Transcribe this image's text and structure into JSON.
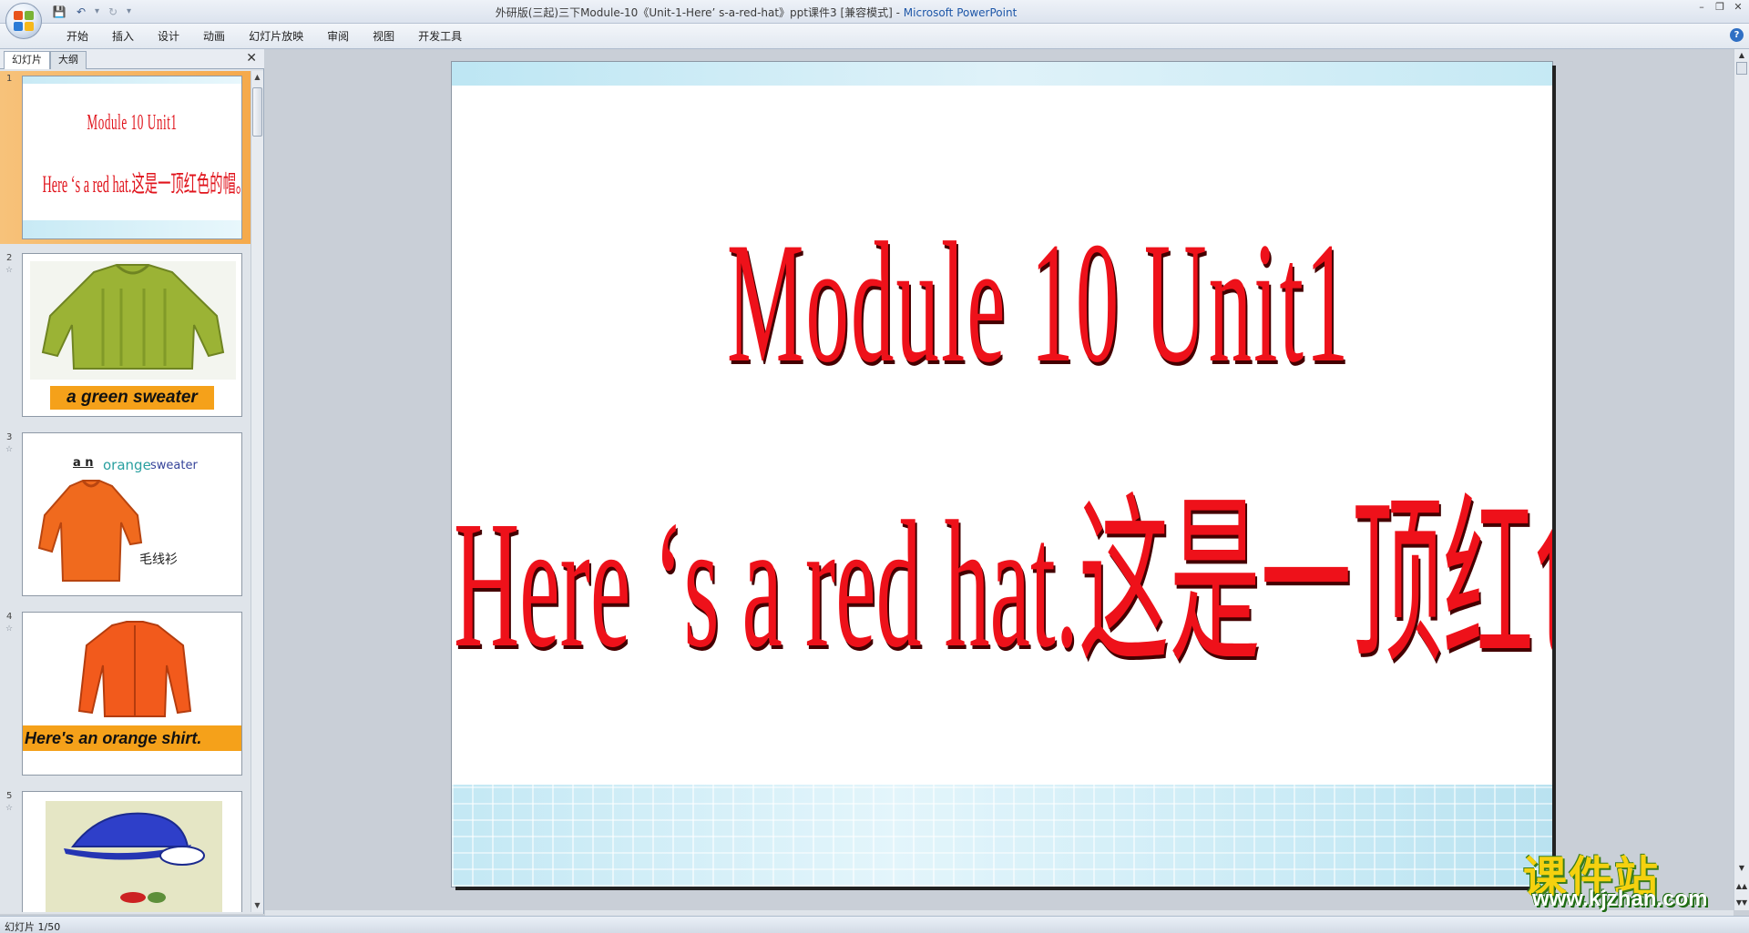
{
  "window": {
    "title": "外研版(三起)三下Module-10《Unit-1-Here’ s-a-red-hat》ppt课件3 [兼容模式] - ",
    "app_name": "Microsoft PowerPoint"
  },
  "ribbon": {
    "tabs": [
      "开始",
      "插入",
      "设计",
      "动画",
      "幻灯片放映",
      "审阅",
      "视图",
      "开发工具"
    ]
  },
  "left_panel": {
    "tab_slides": "幻灯片",
    "tab_outline": "大纲",
    "slides": [
      {
        "num": "1",
        "line1": "Module 10 Unit1",
        "line2": "Here ‘s a red hat.这是一顶红色的帽。."
      },
      {
        "num": "2",
        "label": "a  green  sweater"
      },
      {
        "num": "3",
        "article": "a n",
        "color_word": "orange",
        "noun": "sweater",
        "cn": "毛线衫"
      },
      {
        "num": "4",
        "label": "Here's an orange  shirt."
      },
      {
        "num": "5"
      }
    ]
  },
  "slide": {
    "title": "Module 10 Unit1",
    "subtitle": "Here ‘s a red hat.这是一顶红色的帽。."
  },
  "status": {
    "slide_counter": "幻灯片 1/50"
  },
  "watermark": {
    "cn": "课件站",
    "url": "www.kjzhan.com"
  },
  "colors": {
    "title_red": "#ee111a",
    "label_orange": "#f5a11a",
    "band_blue": "#c3e8f4"
  }
}
